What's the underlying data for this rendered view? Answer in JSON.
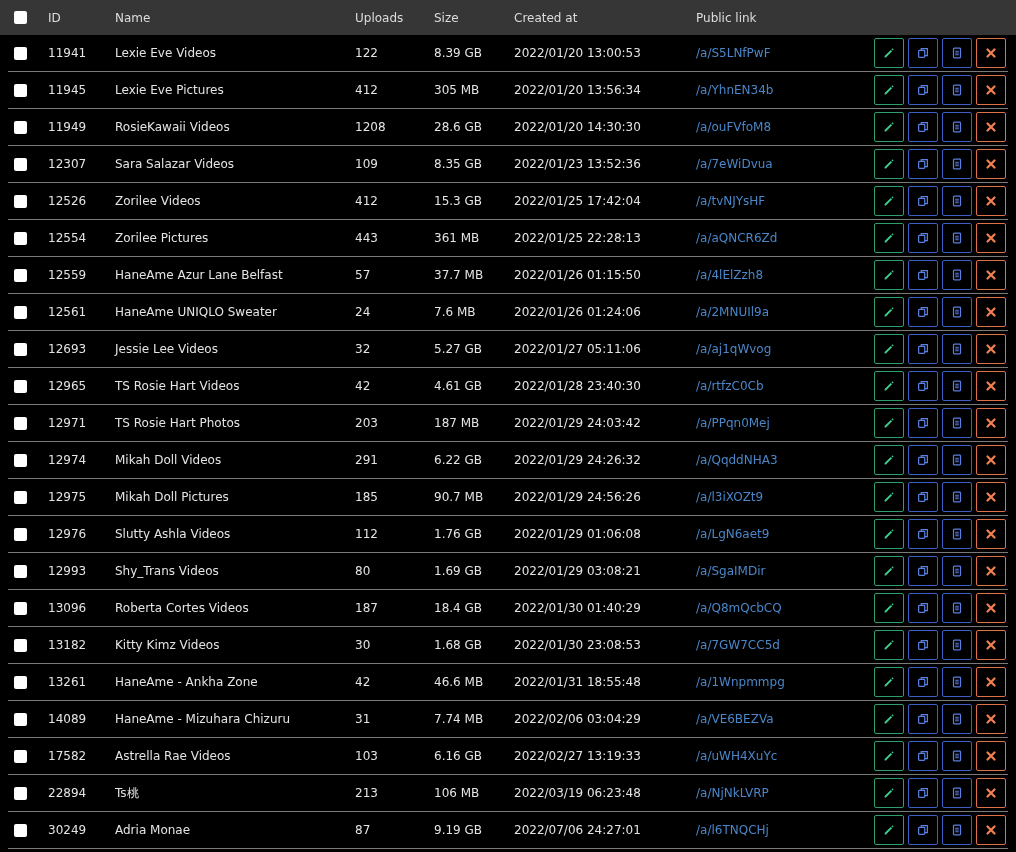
{
  "table": {
    "select_all": {
      "checked": false
    },
    "columns": [
      "ID",
      "Name",
      "Uploads",
      "Size",
      "Created at",
      "Public link"
    ],
    "rows": [
      {
        "checked": false,
        "id": "11941",
        "name": "Lexie Eve Videos",
        "uploads": "122",
        "size": "8.39 GB",
        "created": "2022/01/20 13:00:53",
        "link": "/a/S5LNfPwF"
      },
      {
        "checked": false,
        "id": "11945",
        "name": "Lexie Eve Pictures",
        "uploads": "412",
        "size": "305 MB",
        "created": "2022/01/20 13:56:34",
        "link": "/a/YhnEN34b"
      },
      {
        "checked": false,
        "id": "11949",
        "name": "RosieKawaii Videos",
        "uploads": "1208",
        "size": "28.6 GB",
        "created": "2022/01/20 14:30:30",
        "link": "/a/ouFVfoM8"
      },
      {
        "checked": false,
        "id": "12307",
        "name": "Sara Salazar Videos",
        "uploads": "109",
        "size": "8.35 GB",
        "created": "2022/01/23 13:52:36",
        "link": "/a/7eWiDvua"
      },
      {
        "checked": false,
        "id": "12526",
        "name": "Zorilee Videos",
        "uploads": "412",
        "size": "15.3 GB",
        "created": "2022/01/25 17:42:04",
        "link": "/a/tvNJYsHF"
      },
      {
        "checked": false,
        "id": "12554",
        "name": "Zorilee Pictures",
        "uploads": "443",
        "size": "361 MB",
        "created": "2022/01/25 22:28:13",
        "link": "/a/aQNCR6Zd"
      },
      {
        "checked": false,
        "id": "12559",
        "name": "HaneAme Azur Lane Belfast",
        "uploads": "57",
        "size": "37.7 MB",
        "created": "2022/01/26 01:15:50",
        "link": "/a/4lElZzh8"
      },
      {
        "checked": false,
        "id": "12561",
        "name": "HaneAme UNIQLO Sweater",
        "uploads": "24",
        "size": "7.6 MB",
        "created": "2022/01/26 01:24:06",
        "link": "/a/2MNUIl9a"
      },
      {
        "checked": false,
        "id": "12693",
        "name": "Jessie Lee Videos",
        "uploads": "32",
        "size": "5.27 GB",
        "created": "2022/01/27 05:11:06",
        "link": "/a/aj1qWvog"
      },
      {
        "checked": false,
        "id": "12965",
        "name": "TS Rosie Hart Videos",
        "uploads": "42",
        "size": "4.61 GB",
        "created": "2022/01/28 23:40:30",
        "link": "/a/rtfzC0Cb"
      },
      {
        "checked": false,
        "id": "12971",
        "name": "TS Rosie Hart Photos",
        "uploads": "203",
        "size": "187 MB",
        "created": "2022/01/29 24:03:42",
        "link": "/a/PPqn0Mej"
      },
      {
        "checked": false,
        "id": "12974",
        "name": "Mikah Doll Videos",
        "uploads": "291",
        "size": "6.22 GB",
        "created": "2022/01/29 24:26:32",
        "link": "/a/QqddNHA3"
      },
      {
        "checked": false,
        "id": "12975",
        "name": "Mikah Doll Pictures",
        "uploads": "185",
        "size": "90.7 MB",
        "created": "2022/01/29 24:56:26",
        "link": "/a/l3iXOZt9"
      },
      {
        "checked": false,
        "id": "12976",
        "name": "Slutty Ashla Videos",
        "uploads": "112",
        "size": "1.76 GB",
        "created": "2022/01/29 01:06:08",
        "link": "/a/LgN6aet9"
      },
      {
        "checked": false,
        "id": "12993",
        "name": "Shy_Trans Videos",
        "uploads": "80",
        "size": "1.69 GB",
        "created": "2022/01/29 03:08:21",
        "link": "/a/SgaIMDir"
      },
      {
        "checked": false,
        "id": "13096",
        "name": "Roberta Cortes Videos",
        "uploads": "187",
        "size": "18.4 GB",
        "created": "2022/01/30 01:40:29",
        "link": "/a/Q8mQcbCQ"
      },
      {
        "checked": false,
        "id": "13182",
        "name": "Kitty Kimz Videos",
        "uploads": "30",
        "size": "1.68 GB",
        "created": "2022/01/30 23:08:53",
        "link": "/a/7GW7CC5d"
      },
      {
        "checked": false,
        "id": "13261",
        "name": "HaneAme - Ankha Zone",
        "uploads": "42",
        "size": "46.6 MB",
        "created": "2022/01/31 18:55:48",
        "link": "/a/1Wnpmmpg"
      },
      {
        "checked": false,
        "id": "14089",
        "name": "HaneAme - Mizuhara Chizuru",
        "uploads": "31",
        "size": "7.74 MB",
        "created": "2022/02/06 03:04:29",
        "link": "/a/VE6BEZVa"
      },
      {
        "checked": false,
        "id": "17582",
        "name": "Astrella Rae Videos",
        "uploads": "103",
        "size": "6.16 GB",
        "created": "2022/02/27 13:19:33",
        "link": "/a/uWH4XuYc"
      },
      {
        "checked": false,
        "id": "22894",
        "name": "Ts桃",
        "uploads": "213",
        "size": "106 MB",
        "created": "2022/03/19 06:23:48",
        "link": "/a/NjNkLVRP"
      },
      {
        "checked": false,
        "id": "30249",
        "name": "Adria Monae",
        "uploads": "87",
        "size": "9.19 GB",
        "created": "2022/07/06 24:27:01",
        "link": "/a/l6TNQCHj"
      }
    ]
  }
}
